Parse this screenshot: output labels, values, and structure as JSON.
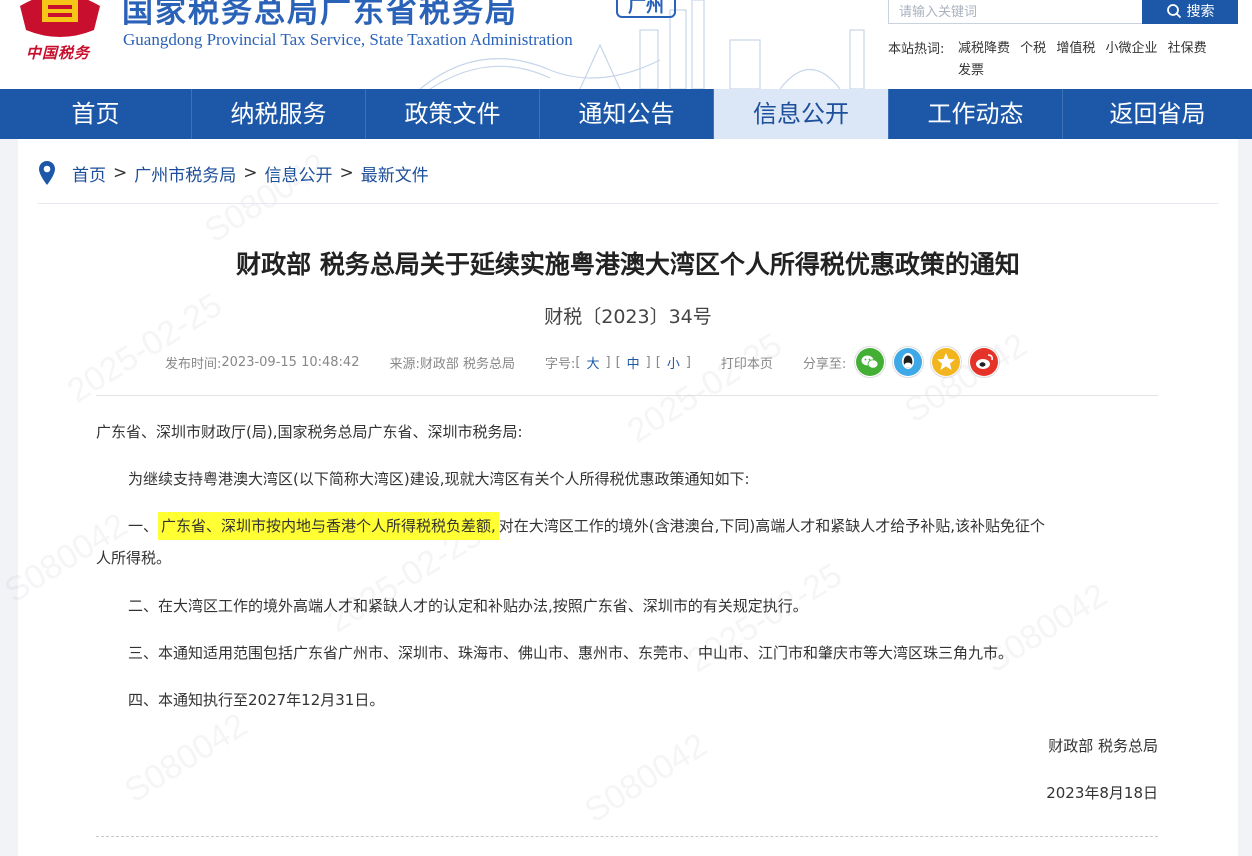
{
  "header": {
    "emblem_caption": "中国税务",
    "title_cn": "国家税务总局广东省税务局",
    "city_badge": "广州",
    "title_en": "Guangdong Provincial Tax Service, State Taxation Administration",
    "search": {
      "placeholder": "请输入关键词",
      "button_label": "搜索"
    },
    "hot_label": "本站热词:",
    "hot_words": [
      "减税降费",
      "个税",
      "增值税",
      "小微企业",
      "社保费",
      "发票"
    ]
  },
  "nav": {
    "items": [
      "首页",
      "纳税服务",
      "政策文件",
      "通知公告",
      "信息公开",
      "工作动态",
      "返回省局"
    ],
    "active_index": 4
  },
  "breadcrumb": [
    "首页",
    "广州市税务局",
    "信息公开",
    "最新文件"
  ],
  "article": {
    "title": "财政部 税务总局关于延续实施粤港澳大湾区个人所得税优惠政策的通知",
    "doc_number": "财税〔2023〕34号",
    "meta": {
      "publish_label": "发布时间:",
      "publish_time": "2023-09-15 10:48:42",
      "source_label": "来源:",
      "source": "财政部 税务总局",
      "font_label": "字号:",
      "font_sizes": [
        "大",
        "中",
        "小"
      ],
      "print_label": "打印本页",
      "share_label": "分享至:"
    },
    "salutation": "广东省、深圳市财政厅(局),国家税务总局广东省、深圳市税务局:",
    "intro": "为继续支持粤港澳大湾区(以下简称大湾区)建设,现就大湾区有关个人所得税优惠政策通知如下:",
    "item1_prefix": "一、",
    "item1_highlight": "广东省、深圳市按内地与香港个人所得税税负差额,",
    "item1_rest": "对在大湾区工作的境外(含港澳台,下同)高端人才和紧缺人才给予补贴,该补贴免征个",
    "item1_cont": "人所得税。",
    "item2": "二、在大湾区工作的境外高端人才和紧缺人才的认定和补贴办法,按照广东省、深圳市的有关规定执行。",
    "item3": "三、本通知适用范围包括广东省广州市、深圳市、珠海市、佛山市、惠州市、东莞市、中山市、江门市和肇庆市等大湾区珠三角九市。",
    "item4": "四、本通知执行至2027年12月31日。",
    "signature": "财政部 税务总局",
    "date": "2023年8月18日"
  },
  "watermark": {
    "text1": "S080042",
    "text2": "2025-02-25"
  },
  "colors": {
    "brand_blue": "#1d58a8",
    "highlight": "#ffff33",
    "emblem_red": "#c8102e"
  }
}
